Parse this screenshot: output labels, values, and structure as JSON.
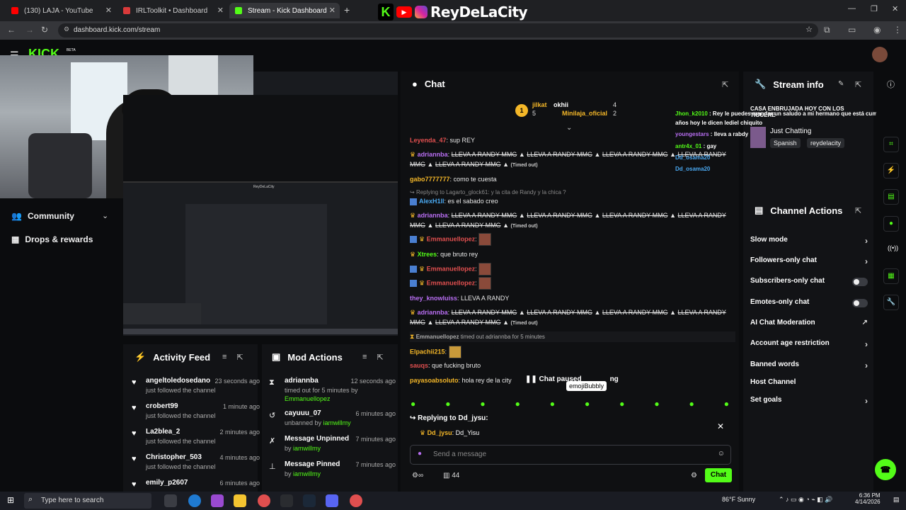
{
  "browser": {
    "tabs": [
      {
        "title": "(130) LAJA - YouTube",
        "color": "#ff0000"
      },
      {
        "title": "IRLToolkit • Dashboard",
        "color": "#d93a3a"
      },
      {
        "title": "Stream - Kick Dashboard",
        "color": "#53fc18"
      }
    ],
    "url": "dashboard.kick.com/stream"
  },
  "overlay": {
    "name": "ReyDeLaCity"
  },
  "kick": {
    "logo": "KICK",
    "beta": "BETA"
  },
  "sidebar": {
    "community": "Community",
    "drops": "Drops & rewards"
  },
  "video": {
    "title": "ReyDeLaCity"
  },
  "activity": {
    "title": "Activity Feed",
    "items": [
      {
        "name": "angeltoledosedano",
        "time": "23 seconds ago",
        "sub": "just followed the channel"
      },
      {
        "name": "crobert99",
        "time": "1 minute ago",
        "sub": "just followed the channel"
      },
      {
        "name": "La2blea_2",
        "time": "2 minutes ago",
        "sub": "just followed the channel"
      },
      {
        "name": "Christopher_503",
        "time": "4 minutes ago",
        "sub": "just followed the channel"
      },
      {
        "name": "emily_p2607",
        "time": "6 minutes ago",
        "sub": ""
      }
    ]
  },
  "mod": {
    "title": "Mod Actions",
    "items": [
      {
        "name": "adriannba",
        "time": "12 seconds ago",
        "sub": "timed out for 5 minutes by",
        "by": "Emmanuellopez"
      },
      {
        "name": "cayuuu_07",
        "time": "6 minutes ago",
        "sub": "unbanned by",
        "by": "iamwillmy"
      },
      {
        "name": "Message Unpinned",
        "time": "7 minutes ago",
        "sub": "by",
        "by": "iamwillmy"
      },
      {
        "name": "Message Pinned",
        "time": "7 minutes ago",
        "sub": "by",
        "by": "iamwillmy"
      }
    ]
  },
  "chat": {
    "title": "Chat",
    "leaders": {
      "first": "jilkat",
      "first_count": "5",
      "second": "okhii",
      "second_count": "4",
      "third": "Minilaja_oficial",
      "third_count": "2"
    },
    "spam": "LLEVA A RANDY MMG",
    "timed_out": "(Timed out)",
    "lines": [
      {
        "user": "Leyenda_47",
        "text": "sup REY",
        "color": "#e04f4f"
      },
      {
        "user": "adriannba",
        "text": "",
        "color": "#b86ef2"
      },
      {
        "user": "gabo7777777",
        "text": "como te cuesta",
        "color": "#f4b728"
      },
      {
        "user": "",
        "text": "Replying to Lagarto_glock61: y la cita de Randy y la chica ?",
        "color": "#888"
      },
      {
        "user": "AlexH1ll",
        "text": "es el sabado creo",
        "color": "#4aa8f0"
      },
      {
        "user": "Emmanuellopez",
        "text": ":",
        "color": "#e04f4f"
      },
      {
        "user": "Xtrees",
        "text": "que bruto rey",
        "color": "#53fc18"
      },
      {
        "user": "they_knowluiss",
        "text": "LLEVA A RANDY",
        "color": "#b86ef2"
      },
      {
        "user": "Emmanuellopez",
        "text": "timed out adriannba for 5 minutes",
        "color": "#aaa"
      },
      {
        "user": "Elpachii215",
        "text": ":",
        "color": "#f4b728"
      },
      {
        "user": "sauqs",
        "text": "que fucking bruto",
        "color": "#e04f4f"
      },
      {
        "user": "payasoabsoluto",
        "text": "hola rey de la city",
        "color": "#f4b728"
      }
    ],
    "paused": "Chat paused",
    "paused_tail": "ng",
    "tooltip": "emojiBubbly",
    "reply_label": "Replying to Dd_jysu:",
    "reply_user": "Dd_jysu",
    "reply_text": "Dd_Yisu",
    "placeholder": "Send a message",
    "viewers": "44",
    "send": "Chat"
  },
  "streaminfo": {
    "title": "Stream info",
    "stream_title": "CASA ENBRUJADA HOY CON LOS TIGUERE",
    "category": "Just Chatting",
    "tags": [
      "Spanish",
      "reydelacity"
    ]
  },
  "overlay_chat": [
    {
      "user": "Jhon_k2010",
      "text": "Rey le puedes mandar un saludo a mi hermano que está cumpliendo"
    },
    {
      "user": "",
      "text": "años hoy le dicen lediel chiquito"
    },
    {
      "user": "youngestars",
      "text": "lleva a rabdy"
    },
    {
      "user": "antr4x_01",
      "text": "gay"
    },
    {
      "user": "Dd_osama20",
      "text": ""
    },
    {
      "user": "Dd_osama20",
      "text": ""
    }
  ],
  "actions": {
    "title": "Channel Actions",
    "items": [
      "Slow mode",
      "Followers-only chat",
      "Subscribers-only chat",
      "Emotes-only chat",
      "AI Chat Moderation",
      "Account age restriction",
      "Banned words",
      "Host Channel",
      "Set goals"
    ]
  },
  "taskbar": {
    "search": "Type here to search",
    "weather": "86°F  Sunny",
    "time": "6:36 PM",
    "date": "4/14/2026"
  }
}
